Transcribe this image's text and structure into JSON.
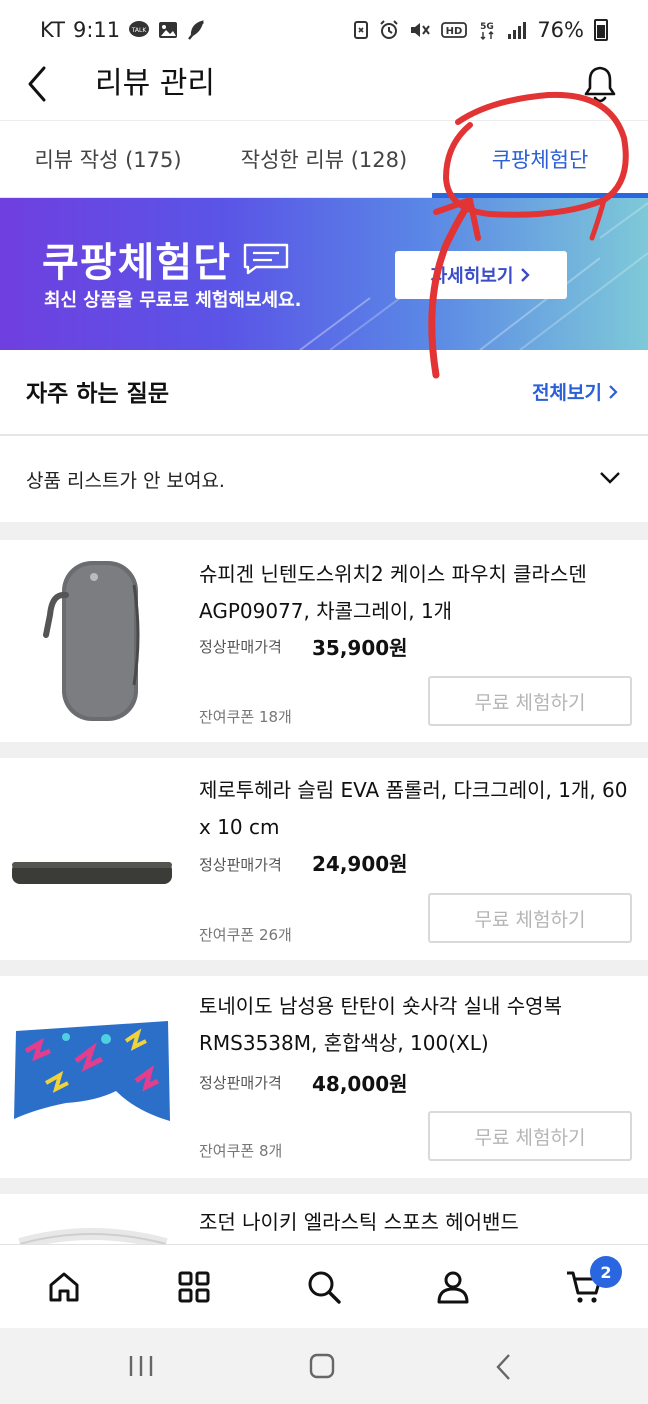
{
  "status_bar": {
    "carrier": "KT",
    "time": "9:11",
    "battery_percent": "76%",
    "icons": [
      "talk-icon",
      "gallery-icon",
      "feather-icon",
      "nfc-icon",
      "alarm-icon",
      "mute-icon",
      "hd-icon",
      "5g-icon",
      "signal-icon",
      "battery-icon"
    ]
  },
  "header": {
    "title": "리뷰 관리",
    "back_icon": "back-arrow-icon",
    "bell_icon": "bell-icon"
  },
  "tabs": [
    {
      "label": "리뷰 작성 (175)",
      "active": false
    },
    {
      "label": "작성한 리뷰 (128)",
      "active": false
    },
    {
      "label": "쿠팡체험단",
      "active": true
    }
  ],
  "banner": {
    "title": "쿠팡체험단",
    "subtitle": "최신 상품을 무료로 체험해보세요.",
    "button_label": "자세히보기"
  },
  "faq": {
    "title": "자주 하는 질문",
    "more_label": "전체보기",
    "items": [
      {
        "question": "상품 리스트가 안 보여요."
      }
    ]
  },
  "price_label": "정상판매가격",
  "trial_button_label": "무료 체험하기",
  "products": [
    {
      "name": "슈피겐 닌텐도스위치2 케이스 파우치 클라스덴 AGP09077, 차콜그레이, 1개",
      "price": "35,900원",
      "coupon": "잔여쿠폰 18개",
      "image": "gray-case-pouch"
    },
    {
      "name": "제로투헤라 슬림 EVA 폼롤러, 다크그레이, 1개, 60 x 10 cm",
      "price": "24,900원",
      "coupon": "잔여쿠폰 26개",
      "image": "foam-roller"
    },
    {
      "name": "토네이도 남성용 탄탄이 숏사각 실내 수영복 RMS3538M, 혼합색상, 100(XL)",
      "price": "48,000원",
      "coupon": "잔여쿠폰 8개",
      "image": "swim-trunks"
    },
    {
      "name": "조던 나이키 엘라스틱 스포츠 헤어밴드",
      "image": "headband"
    }
  ],
  "bottom_nav": {
    "items": [
      "home-icon",
      "category-icon",
      "search-icon",
      "account-icon",
      "cart-icon"
    ],
    "cart_count": "2"
  },
  "colors": {
    "accent": "#2a66e0",
    "annotation": "#e23434",
    "banner_start": "#6f3fe0",
    "banner_end": "#7ec9d8"
  }
}
